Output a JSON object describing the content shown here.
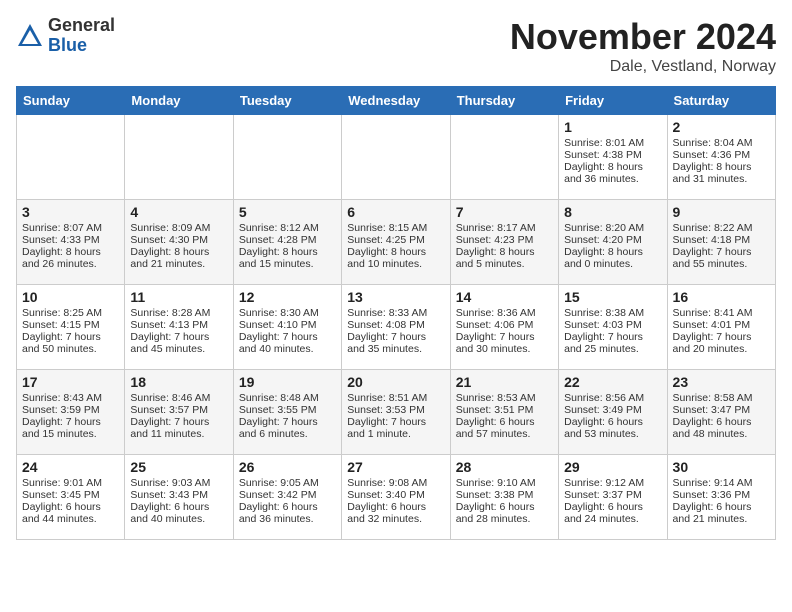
{
  "header": {
    "logo_general": "General",
    "logo_blue": "Blue",
    "month_year": "November 2024",
    "location": "Dale, Vestland, Norway"
  },
  "days_of_week": [
    "Sunday",
    "Monday",
    "Tuesday",
    "Wednesday",
    "Thursday",
    "Friday",
    "Saturday"
  ],
  "weeks": [
    [
      {
        "day": "",
        "info": ""
      },
      {
        "day": "",
        "info": ""
      },
      {
        "day": "",
        "info": ""
      },
      {
        "day": "",
        "info": ""
      },
      {
        "day": "",
        "info": ""
      },
      {
        "day": "1",
        "info": "Sunrise: 8:01 AM\nSunset: 4:38 PM\nDaylight: 8 hours and 36 minutes."
      },
      {
        "day": "2",
        "info": "Sunrise: 8:04 AM\nSunset: 4:36 PM\nDaylight: 8 hours and 31 minutes."
      }
    ],
    [
      {
        "day": "3",
        "info": "Sunrise: 8:07 AM\nSunset: 4:33 PM\nDaylight: 8 hours and 26 minutes."
      },
      {
        "day": "4",
        "info": "Sunrise: 8:09 AM\nSunset: 4:30 PM\nDaylight: 8 hours and 21 minutes."
      },
      {
        "day": "5",
        "info": "Sunrise: 8:12 AM\nSunset: 4:28 PM\nDaylight: 8 hours and 15 minutes."
      },
      {
        "day": "6",
        "info": "Sunrise: 8:15 AM\nSunset: 4:25 PM\nDaylight: 8 hours and 10 minutes."
      },
      {
        "day": "7",
        "info": "Sunrise: 8:17 AM\nSunset: 4:23 PM\nDaylight: 8 hours and 5 minutes."
      },
      {
        "day": "8",
        "info": "Sunrise: 8:20 AM\nSunset: 4:20 PM\nDaylight: 8 hours and 0 minutes."
      },
      {
        "day": "9",
        "info": "Sunrise: 8:22 AM\nSunset: 4:18 PM\nDaylight: 7 hours and 55 minutes."
      }
    ],
    [
      {
        "day": "10",
        "info": "Sunrise: 8:25 AM\nSunset: 4:15 PM\nDaylight: 7 hours and 50 minutes."
      },
      {
        "day": "11",
        "info": "Sunrise: 8:28 AM\nSunset: 4:13 PM\nDaylight: 7 hours and 45 minutes."
      },
      {
        "day": "12",
        "info": "Sunrise: 8:30 AM\nSunset: 4:10 PM\nDaylight: 7 hours and 40 minutes."
      },
      {
        "day": "13",
        "info": "Sunrise: 8:33 AM\nSunset: 4:08 PM\nDaylight: 7 hours and 35 minutes."
      },
      {
        "day": "14",
        "info": "Sunrise: 8:36 AM\nSunset: 4:06 PM\nDaylight: 7 hours and 30 minutes."
      },
      {
        "day": "15",
        "info": "Sunrise: 8:38 AM\nSunset: 4:03 PM\nDaylight: 7 hours and 25 minutes."
      },
      {
        "day": "16",
        "info": "Sunrise: 8:41 AM\nSunset: 4:01 PM\nDaylight: 7 hours and 20 minutes."
      }
    ],
    [
      {
        "day": "17",
        "info": "Sunrise: 8:43 AM\nSunset: 3:59 PM\nDaylight: 7 hours and 15 minutes."
      },
      {
        "day": "18",
        "info": "Sunrise: 8:46 AM\nSunset: 3:57 PM\nDaylight: 7 hours and 11 minutes."
      },
      {
        "day": "19",
        "info": "Sunrise: 8:48 AM\nSunset: 3:55 PM\nDaylight: 7 hours and 6 minutes."
      },
      {
        "day": "20",
        "info": "Sunrise: 8:51 AM\nSunset: 3:53 PM\nDaylight: 7 hours and 1 minute."
      },
      {
        "day": "21",
        "info": "Sunrise: 8:53 AM\nSunset: 3:51 PM\nDaylight: 6 hours and 57 minutes."
      },
      {
        "day": "22",
        "info": "Sunrise: 8:56 AM\nSunset: 3:49 PM\nDaylight: 6 hours and 53 minutes."
      },
      {
        "day": "23",
        "info": "Sunrise: 8:58 AM\nSunset: 3:47 PM\nDaylight: 6 hours and 48 minutes."
      }
    ],
    [
      {
        "day": "24",
        "info": "Sunrise: 9:01 AM\nSunset: 3:45 PM\nDaylight: 6 hours and 44 minutes."
      },
      {
        "day": "25",
        "info": "Sunrise: 9:03 AM\nSunset: 3:43 PM\nDaylight: 6 hours and 40 minutes."
      },
      {
        "day": "26",
        "info": "Sunrise: 9:05 AM\nSunset: 3:42 PM\nDaylight: 6 hours and 36 minutes."
      },
      {
        "day": "27",
        "info": "Sunrise: 9:08 AM\nSunset: 3:40 PM\nDaylight: 6 hours and 32 minutes."
      },
      {
        "day": "28",
        "info": "Sunrise: 9:10 AM\nSunset: 3:38 PM\nDaylight: 6 hours and 28 minutes."
      },
      {
        "day": "29",
        "info": "Sunrise: 9:12 AM\nSunset: 3:37 PM\nDaylight: 6 hours and 24 minutes."
      },
      {
        "day": "30",
        "info": "Sunrise: 9:14 AM\nSunset: 3:36 PM\nDaylight: 6 hours and 21 minutes."
      }
    ]
  ]
}
